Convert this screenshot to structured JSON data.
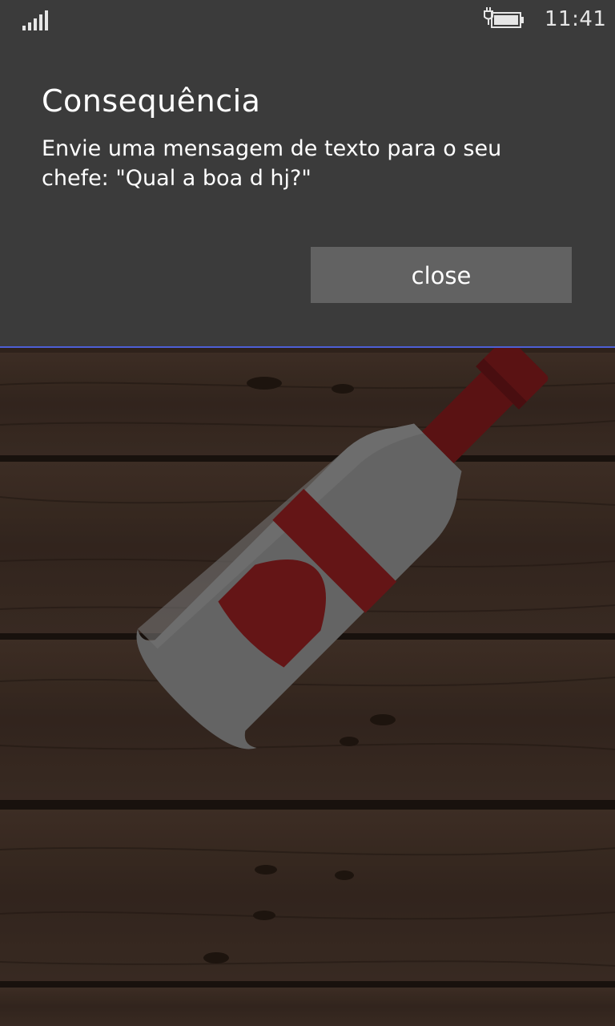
{
  "status_bar": {
    "time": "11:41",
    "signal_icon": "signal-strength-icon",
    "battery_icon": "battery-charging-icon"
  },
  "dialog": {
    "title": "Consequência",
    "message": "Envie uma mensagem de texto para o seu chefe: \"Qual a boa d hj?\"",
    "close_label": "close"
  },
  "colors": {
    "dialog_bg": "#3b3b3b",
    "button_bg": "#626262",
    "accent_line": "#4d5fd6",
    "wood_dark": "#3b2b22",
    "bottle_glass": "#777777",
    "bottle_red": "#7a1a1c"
  }
}
